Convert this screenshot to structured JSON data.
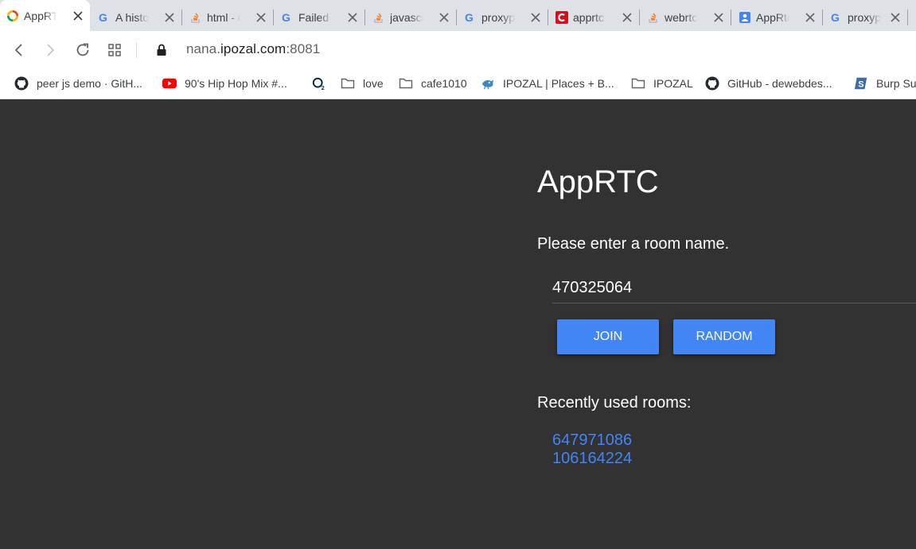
{
  "browser": {
    "tabs": [
      {
        "title": "AppRTC",
        "active": true,
        "icon": "apprtc-favicon-icon"
      },
      {
        "title": "A history",
        "icon": "google-favicon-icon"
      },
      {
        "title": "html - u",
        "icon": "stackoverflow-favicon-icon"
      },
      {
        "title": "Failed t",
        "icon": "google-favicon-icon"
      },
      {
        "title": "javascript",
        "icon": "stackoverflow-favicon-icon"
      },
      {
        "title": "proxypa",
        "icon": "google-favicon-icon"
      },
      {
        "title": "apprtc",
        "icon": "codepen-red-favicon-icon"
      },
      {
        "title": "webrtc",
        "icon": "stackoverflow-favicon-icon"
      },
      {
        "title": "AppRtc",
        "icon": "blue-doc-favicon-icon"
      },
      {
        "title": "proxyp",
        "icon": "google-favicon-icon"
      }
    ],
    "url": {
      "subdomain": "nana.",
      "domain": "ipozal.com",
      "port": ":8081"
    },
    "bookmarks": [
      {
        "label": "peer js demo · GitH...",
        "icon": "github-icon"
      },
      {
        "label": "90's Hip Hop Mix #...",
        "icon": "youtube-icon"
      },
      {
        "label": "",
        "icon": "o2-icon"
      },
      {
        "label": "love",
        "icon": "folder-icon"
      },
      {
        "label": "cafe1010",
        "icon": "folder-icon"
      },
      {
        "label": "IPOZAL | Places + B...",
        "icon": "ipozal-bird-icon"
      },
      {
        "label": "IPOZAL",
        "icon": "folder-icon"
      },
      {
        "label": "GitHub - dewebdes...",
        "icon": "github-icon"
      },
      {
        "label": "Burp Su",
        "icon": "burp-icon"
      }
    ]
  },
  "app": {
    "title": "AppRTC",
    "prompt": "Please enter a room name.",
    "room_value": "470325064",
    "join_label": "JOIN",
    "random_label": "RANDOM",
    "recent_label": "Recently used rooms:",
    "recent_rooms": [
      "647971086",
      "106164224"
    ]
  },
  "colors": {
    "accent": "#4285f4",
    "page_bg": "#323232",
    "tabstrip_bg": "#dee1e6"
  }
}
